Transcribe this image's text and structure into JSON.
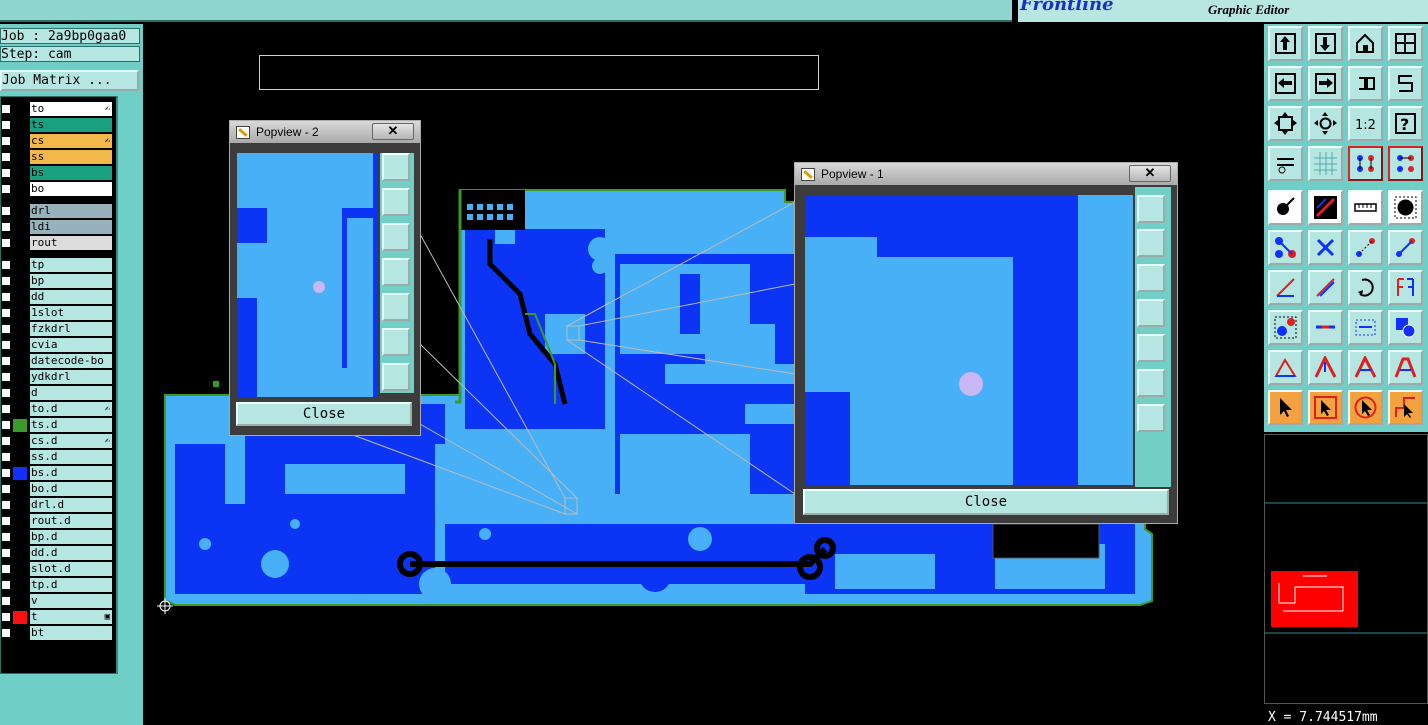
{
  "header": {
    "brand": "Frontline",
    "subtitle": "Graphic Editor"
  },
  "job": {
    "job_label": "Job : 2a9bp0gaa0",
    "step_label": "Step: cam",
    "matrix_button": "Job Matrix ..."
  },
  "layers": [
    {
      "name": "to",
      "color": "#ffffff",
      "swatch": "#000000",
      "mark": "✍"
    },
    {
      "name": "ts",
      "color": "#1aa080",
      "swatch": "#000000",
      "mark": ""
    },
    {
      "name": "cs",
      "color": "#f3b84a",
      "swatch": "#000000",
      "mark": "✍"
    },
    {
      "name": "ss",
      "color": "#f3b84a",
      "swatch": "#000000",
      "mark": ""
    },
    {
      "name": "bs",
      "color": "#1aa080",
      "swatch": "#000000",
      "mark": ""
    },
    {
      "name": "bo",
      "color": "#ffffff",
      "swatch": "#000000",
      "mark": ""
    },
    {
      "name": "drl",
      "color": "#98b2bb",
      "swatch": "#000000",
      "mark": ""
    },
    {
      "name": "ldi",
      "color": "#98b2bb",
      "swatch": "#000000",
      "mark": ""
    },
    {
      "name": "rout",
      "color": "#dcdcdc",
      "swatch": "#000000",
      "mark": ""
    },
    {
      "name": "tp",
      "color": "#b6e6e2",
      "swatch": "#000000",
      "mark": ""
    },
    {
      "name": "bp",
      "color": "#b6e6e2",
      "swatch": "#000000",
      "mark": ""
    },
    {
      "name": "dd",
      "color": "#b6e6e2",
      "swatch": "#000000",
      "mark": ""
    },
    {
      "name": "1slot",
      "color": "#b6e6e2",
      "swatch": "#000000",
      "mark": ""
    },
    {
      "name": "fzkdrl",
      "color": "#b6e6e2",
      "swatch": "#000000",
      "mark": ""
    },
    {
      "name": "cvia",
      "color": "#b6e6e2",
      "swatch": "#000000",
      "mark": ""
    },
    {
      "name": "datecode-bo",
      "color": "#b6e6e2",
      "swatch": "#000000",
      "mark": ""
    },
    {
      "name": "ydkdrl",
      "color": "#b6e6e2",
      "swatch": "#000000",
      "mark": ""
    },
    {
      "name": "d",
      "color": "#b6e6e2",
      "swatch": "#000000",
      "mark": ""
    },
    {
      "name": "to.d",
      "color": "#b6e6e2",
      "swatch": "#000000",
      "mark": "✍"
    },
    {
      "name": "ts.d",
      "color": "#b6e6e2",
      "swatch": "#3a9a2a",
      "mark": ""
    },
    {
      "name": "cs.d",
      "color": "#b6e6e2",
      "swatch": "#000000",
      "mark": "✍"
    },
    {
      "name": "ss.d",
      "color": "#b6e6e2",
      "swatch": "#000000",
      "mark": ""
    },
    {
      "name": "bs.d",
      "color": "#b6e6e2",
      "swatch": "#1030ff",
      "mark": ""
    },
    {
      "name": "bo.d",
      "color": "#b6e6e2",
      "swatch": "#000000",
      "mark": ""
    },
    {
      "name": "drl.d",
      "color": "#b6e6e2",
      "swatch": "#000000",
      "mark": ""
    },
    {
      "name": "rout.d",
      "color": "#b6e6e2",
      "swatch": "#000000",
      "mark": ""
    },
    {
      "name": "bp.d",
      "color": "#b6e6e2",
      "swatch": "#000000",
      "mark": ""
    },
    {
      "name": "dd.d",
      "color": "#b6e6e2",
      "swatch": "#000000",
      "mark": ""
    },
    {
      "name": "slot.d",
      "color": "#b6e6e2",
      "swatch": "#000000",
      "mark": ""
    },
    {
      "name": "tp.d",
      "color": "#b6e6e2",
      "swatch": "#000000",
      "mark": ""
    },
    {
      "name": "v",
      "color": "#b6e6e2",
      "swatch": "#000000",
      "mark": ""
    },
    {
      "name": "t",
      "color": "#b6e6e2",
      "swatch": "#ff1010",
      "mark": "▣"
    },
    {
      "name": "bt",
      "color": "#b6e6e2",
      "swatch": "#000000",
      "mark": ""
    }
  ],
  "popup2": {
    "title": "Popview - 2",
    "close_x": "✕",
    "close_label": "Close"
  },
  "popup1": {
    "title": "Popview - 1",
    "close_x": "✕",
    "close_label": "Close"
  },
  "status": {
    "coords": "X = 7.744517mm"
  },
  "colors": {
    "panel": "#6fcfc6",
    "button": "#b6e6e2",
    "copper": "#0b34f5",
    "pad": "#47b0f7",
    "mask": "#3a9a2a"
  }
}
